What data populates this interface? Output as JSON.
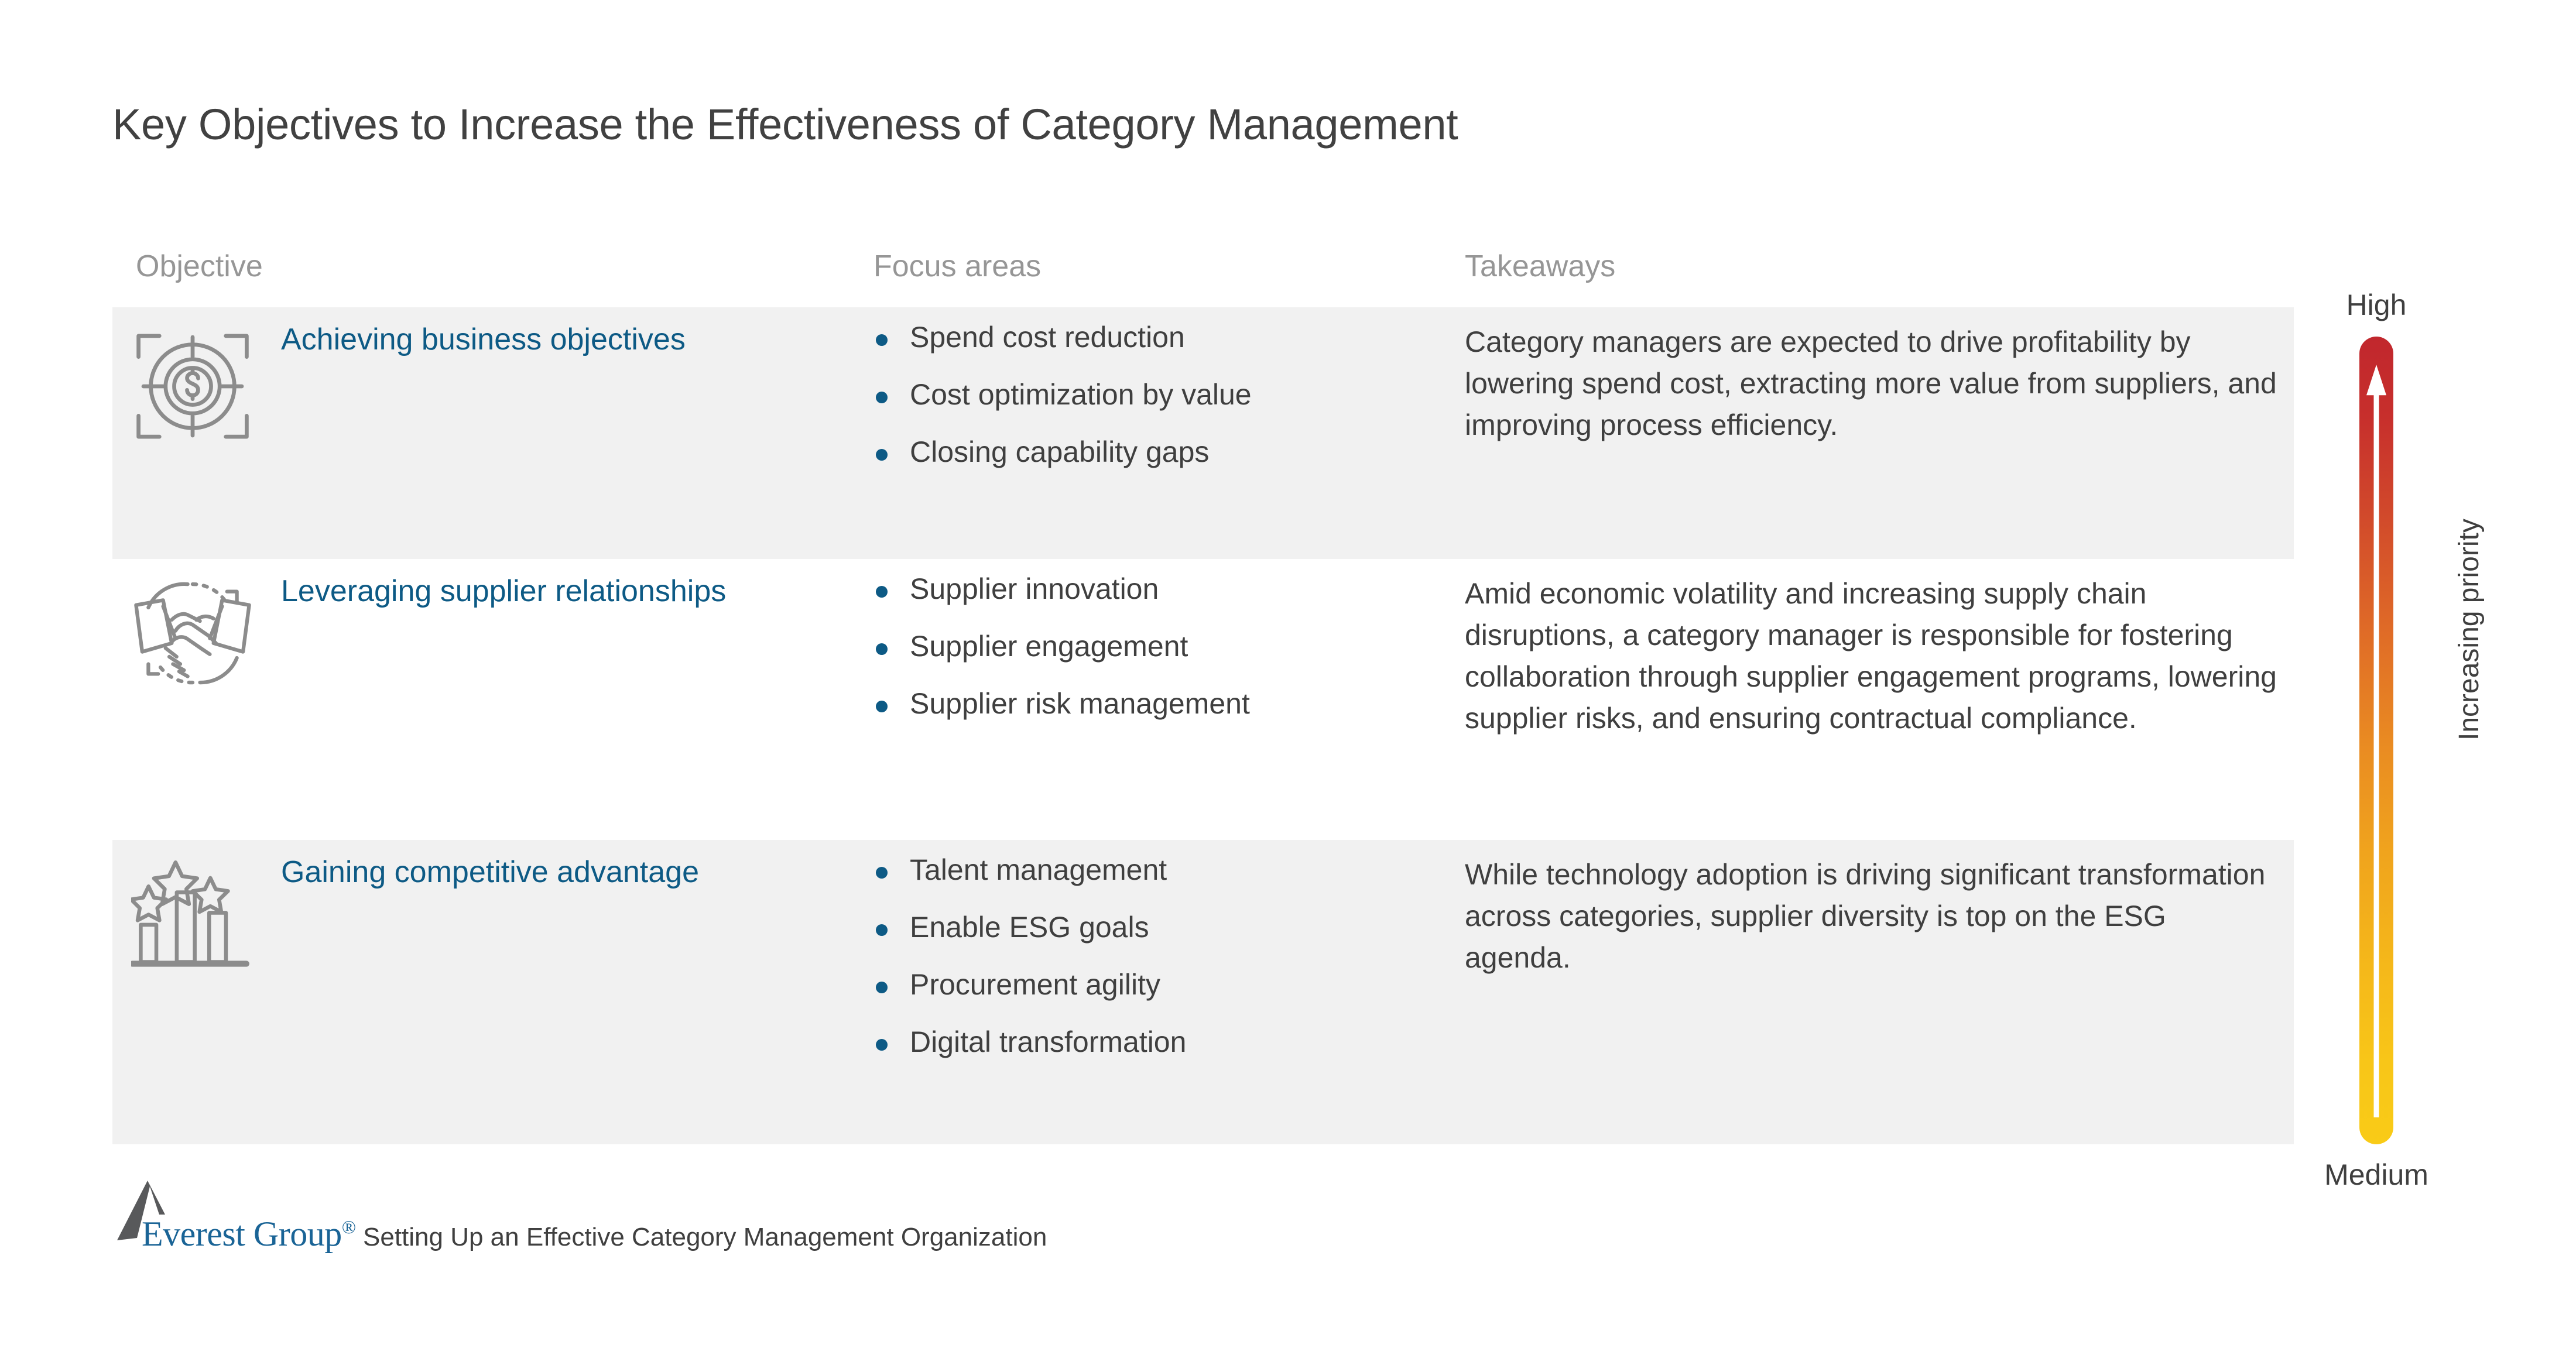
{
  "slide": {
    "title": "Key Objectives to Increase the Effectiveness of Category Management"
  },
  "columns": {
    "objective": "Objective",
    "focus_areas": "Focus areas",
    "takeaways": "Takeaways"
  },
  "rows": [
    {
      "icon": "target-dollar-icon",
      "objective": "Achieving business objectives",
      "focus_areas": [
        "Spend cost reduction",
        "Cost optimization by value",
        "Closing capability gaps"
      ],
      "takeaway": "Category managers are expected to drive profitability by lowering spend cost, extracting more value from suppliers, and improving process efficiency."
    },
    {
      "icon": "handshake-icon",
      "objective": "Leveraging supplier relationships",
      "focus_areas": [
        "Supplier innovation",
        "Supplier engagement",
        "Supplier risk management"
      ],
      "takeaway": "Amid economic volatility and increasing supply chain disruptions, a category manager is responsible for fostering collaboration through supplier engagement programs, lowering supplier risks, and ensuring contractual compliance."
    },
    {
      "icon": "bar-chart-stars-icon",
      "objective": "Gaining competitive advantage",
      "focus_areas": [
        "Talent management",
        "Enable ESG goals",
        "Procurement agility",
        "Digital transformation"
      ],
      "takeaway": "While technology adoption is driving significant transformation across categories, supplier diversity is top on the ESG agenda."
    }
  ],
  "priority_gauge": {
    "top_label": "High",
    "bottom_label": "Medium",
    "axis_label": "Increasing priority",
    "top_color": "#c1272d",
    "bottom_color": "#f9cb17",
    "arrow_color": "#ffffff"
  },
  "footer": {
    "brand": "Everest Group",
    "registered_mark": "®",
    "caption": "Setting Up an Effective Category Management Organization",
    "brand_color": "#1a6496"
  },
  "theme": {
    "accent_blue": "#0d5a85",
    "body_text": "#3f3f3f",
    "header_gray": "#969696",
    "band_gray": "#f1f1f1",
    "icon_gray": "#8c8c8c"
  }
}
